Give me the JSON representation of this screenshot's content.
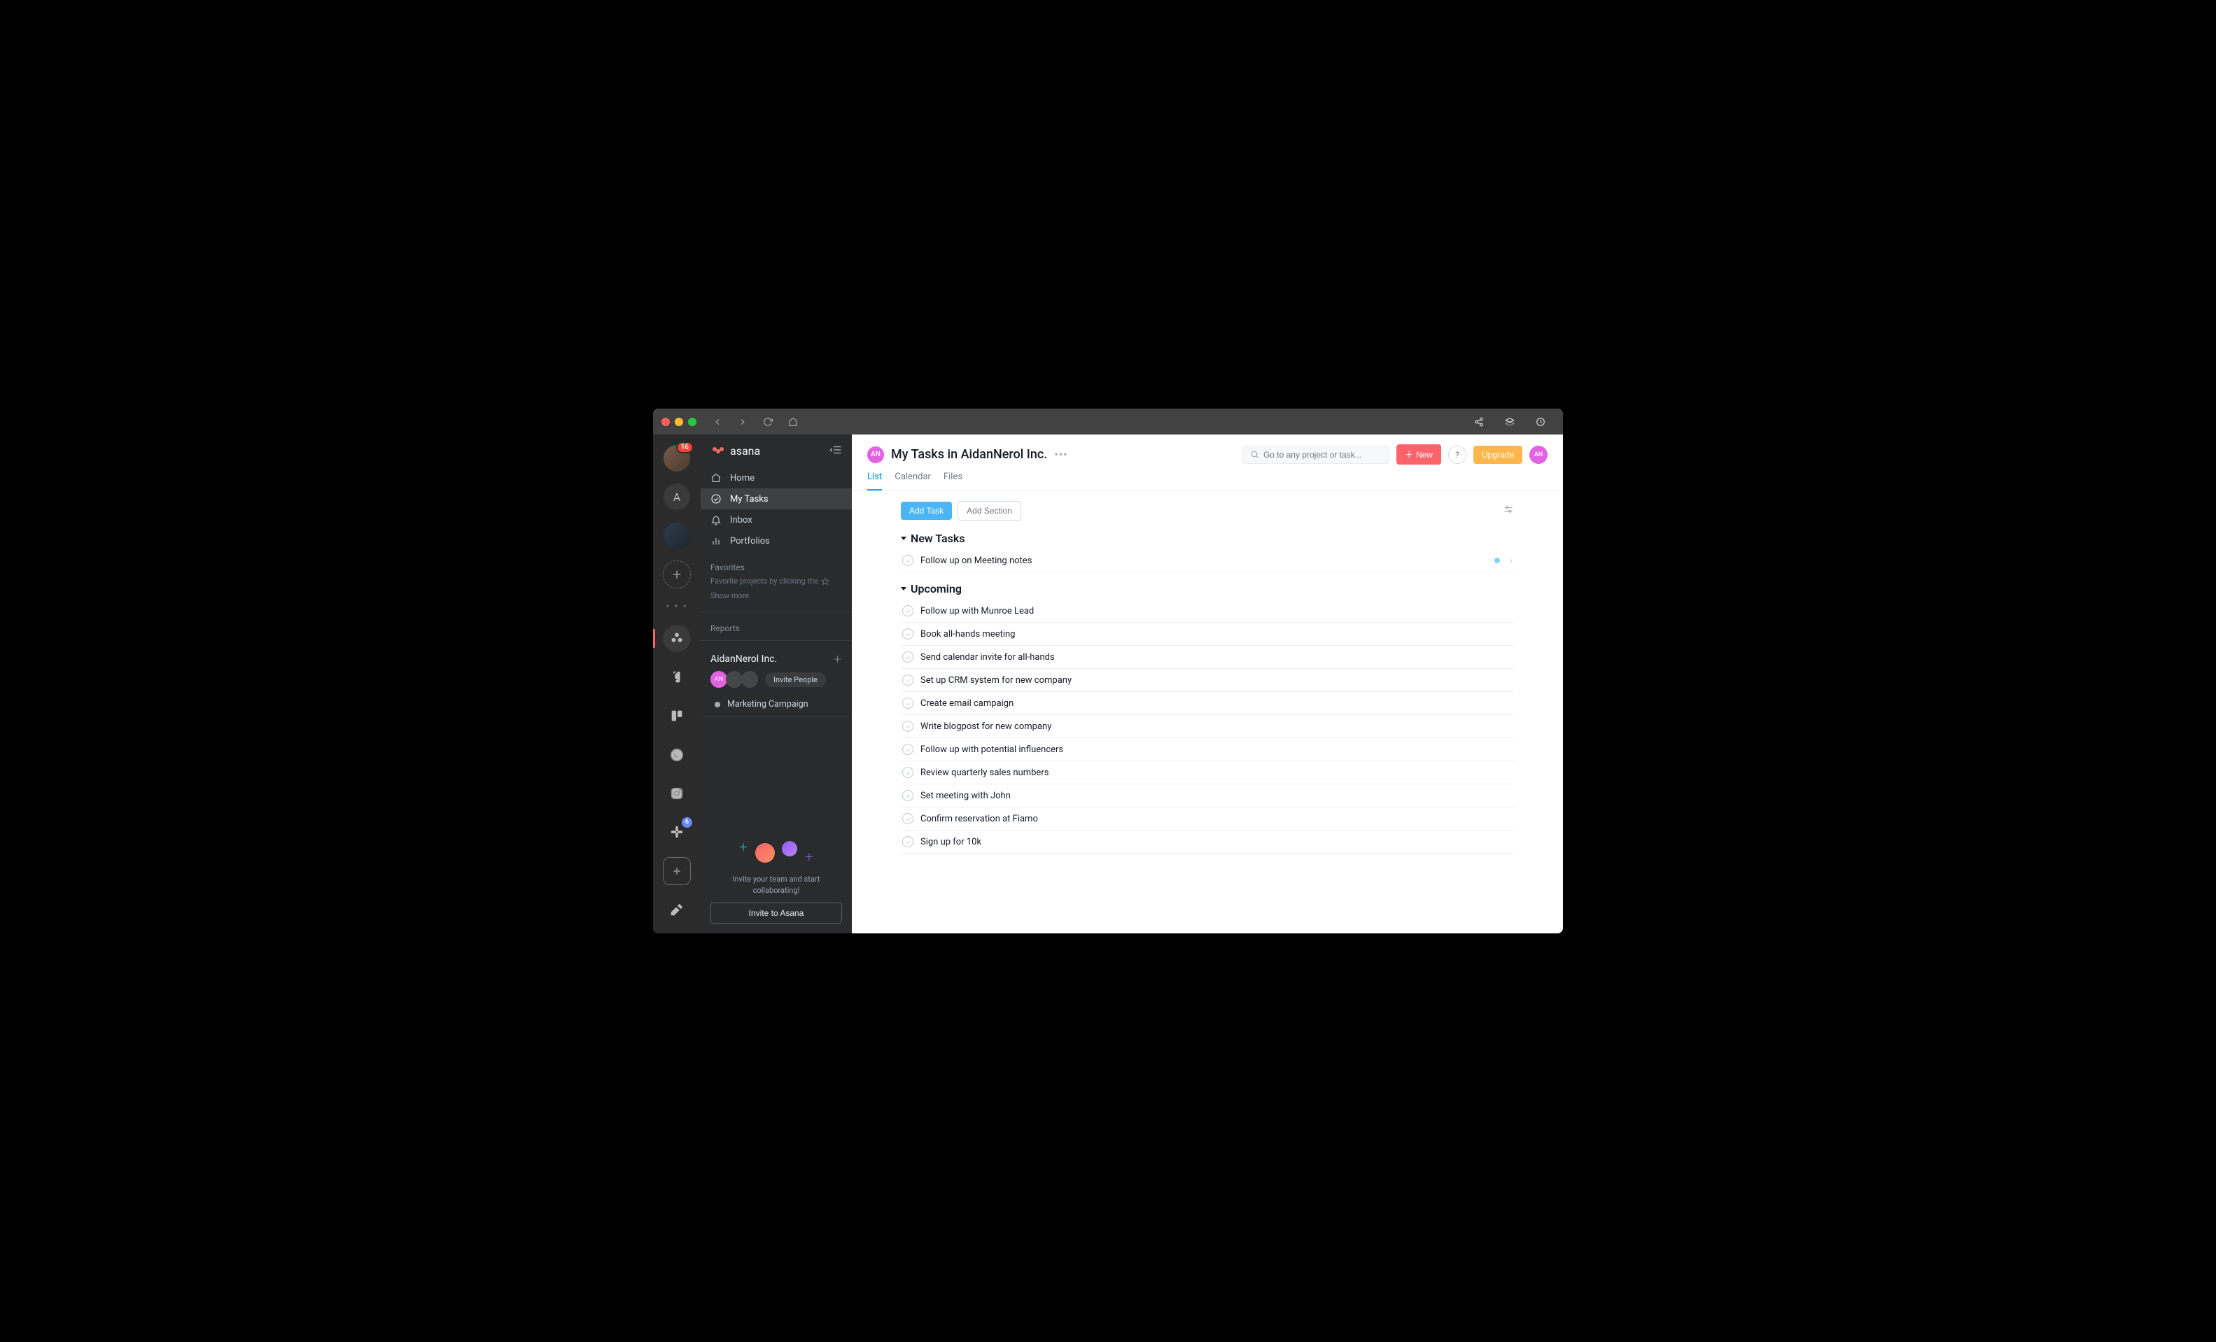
{
  "titlebar": {
    "right_icons": [
      "share-icon",
      "stack-icon",
      "clock-icon"
    ]
  },
  "rail": {
    "badge1": "16",
    "letter_avatar": "A",
    "slack_badge": "6"
  },
  "sidebar": {
    "brand": "asana",
    "nav": [
      {
        "icon": "home-icon",
        "label": "Home"
      },
      {
        "icon": "check-circle-icon",
        "label": "My Tasks"
      },
      {
        "icon": "bell-icon",
        "label": "Inbox"
      },
      {
        "icon": "bars-icon",
        "label": "Portfolios"
      }
    ],
    "favorites_label": "Favorites",
    "favorites_hint": "Favorite projects by clicking the",
    "show_more": "Show more",
    "reports_label": "Reports",
    "workspace": "AidanNerol Inc.",
    "member_initials": "AN",
    "invite_people": "Invite People",
    "project": "Marketing Campaign",
    "footer_line1": "Invite your team and start",
    "footer_line2": "collaborating!",
    "invite_btn": "Invite to Asana"
  },
  "header": {
    "avatar_initials": "AN",
    "title": "My Tasks in AidanNerol Inc.",
    "tabs": [
      "List",
      "Calendar",
      "Files"
    ],
    "active_tab": 0,
    "search_placeholder": "Go to any project or task...",
    "new_btn": "New",
    "help": "?",
    "upgrade": "Upgrade",
    "me_initials": "AN"
  },
  "toolbar": {
    "add_task": "Add Task",
    "add_section": "Add Section"
  },
  "sections": [
    {
      "title": "New Tasks",
      "tasks": [
        {
          "name": "Follow up on Meeting notes",
          "indicator": true
        }
      ]
    },
    {
      "title": "Upcoming",
      "tasks": [
        {
          "name": "Follow up with Munroe Lead"
        },
        {
          "name": "Book all-hands meeting"
        },
        {
          "name": "Send calendar invite for all-hands"
        },
        {
          "name": "Set up CRM system for new company"
        },
        {
          "name": "Create email campaign"
        },
        {
          "name": "Write blogpost for new company"
        },
        {
          "name": "Follow up with potential influencers"
        },
        {
          "name": "Review quarterly sales numbers"
        },
        {
          "name": "Set meeting with John"
        },
        {
          "name": "Confirm reservation at Fiamo"
        },
        {
          "name": "Sign up for 10k"
        }
      ]
    }
  ]
}
